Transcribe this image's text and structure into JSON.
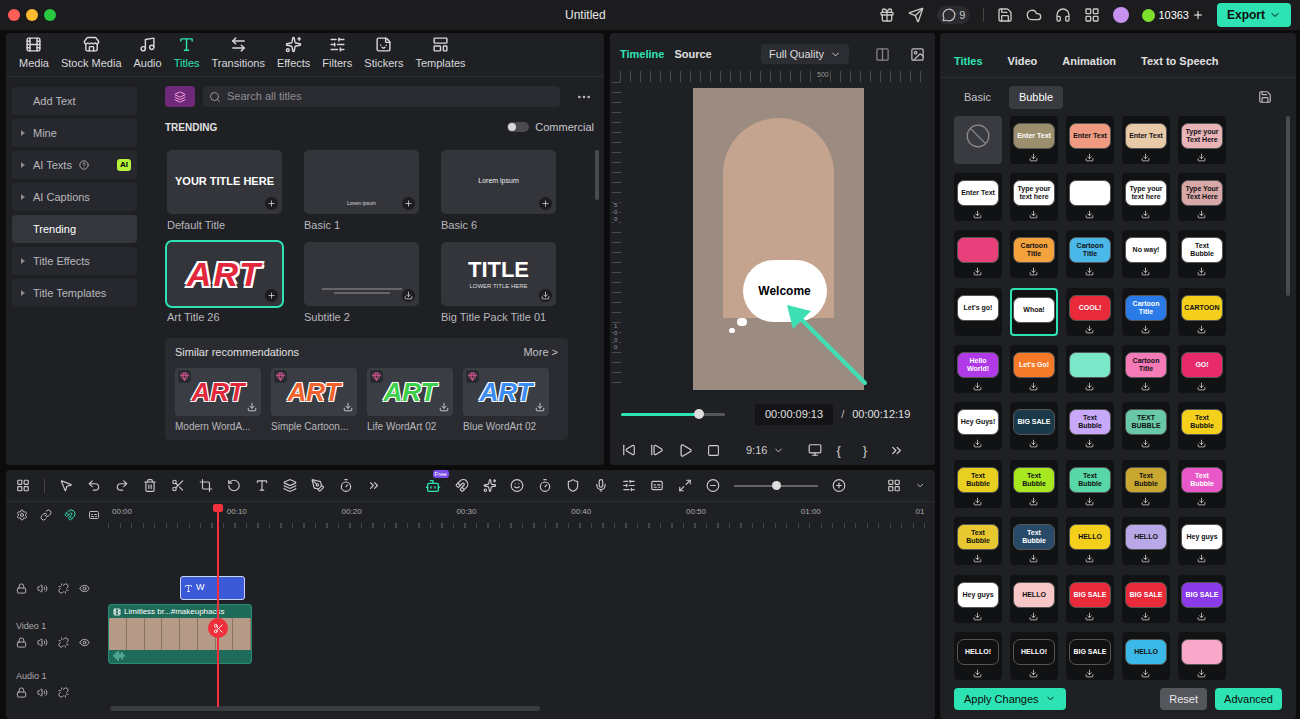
{
  "window": {
    "title": "Untitled"
  },
  "topbar": {
    "notifications": "9",
    "credits": "10363",
    "export": "Export"
  },
  "media_tabs": [
    {
      "label": "Media",
      "selected": false
    },
    {
      "label": "Stock Media",
      "selected": false
    },
    {
      "label": "Audio",
      "selected": false
    },
    {
      "label": "Titles",
      "selected": true
    },
    {
      "label": "Transitions",
      "selected": false
    },
    {
      "label": "Effects",
      "selected": false
    },
    {
      "label": "Filters",
      "selected": false
    },
    {
      "label": "Stickers",
      "selected": false
    },
    {
      "label": "Templates",
      "selected": false
    }
  ],
  "sidebar": [
    {
      "label": "Add Text",
      "kind": "button",
      "selected": false,
      "badge": ""
    },
    {
      "label": "Mine",
      "kind": "group",
      "selected": false,
      "badge": ""
    },
    {
      "label": "AI Texts",
      "kind": "group",
      "selected": false,
      "badge": "AI"
    },
    {
      "label": "AI Captions",
      "kind": "group",
      "selected": false,
      "badge": ""
    },
    {
      "label": "Trending",
      "kind": "item",
      "selected": true,
      "badge": ""
    },
    {
      "label": "Title Effects",
      "kind": "group",
      "selected": false,
      "badge": ""
    },
    {
      "label": "Title Templates",
      "kind": "group",
      "selected": false,
      "badge": ""
    }
  ],
  "search": {
    "placeholder": "Search all titles"
  },
  "section": {
    "title": "TRENDING",
    "toggle_label": "Commercial",
    "toggle_on": false
  },
  "titles": [
    {
      "name": "Default Title",
      "kind": "plain",
      "preview": "YOUR TITLE HERE",
      "preview_sub": "",
      "selected": false,
      "downloaded": true
    },
    {
      "name": "Basic 1",
      "kind": "caption",
      "preview": "Lorem ipsum",
      "preview_sub": "",
      "selected": false,
      "downloaded": true
    },
    {
      "name": "Basic 6",
      "kind": "small",
      "preview": "Lorem ipsum",
      "preview_sub": "",
      "selected": false,
      "downloaded": true
    },
    {
      "name": "Art Title 26",
      "kind": "art",
      "preview": "ART",
      "preview_sub": "",
      "selected": true,
      "downloaded": true
    },
    {
      "name": "Subtitle 2",
      "kind": "subtitle",
      "preview": "",
      "preview_sub": "",
      "selected": false,
      "downloaded": false
    },
    {
      "name": "Big Title Pack Title 01",
      "kind": "big",
      "preview": "TITLE",
      "preview_sub": "LOWER TITLE HERE",
      "selected": false,
      "downloaded": false
    }
  ],
  "recommendations": {
    "title": "Similar recommendations",
    "more": "More >",
    "items": [
      {
        "name": "Modern WordA...",
        "preview": "ART",
        "color": "#e3283c"
      },
      {
        "name": "Simple Cartoon...",
        "preview": "ART",
        "color": "#f0622a"
      },
      {
        "name": "Life WordArt 02",
        "preview": "ART",
        "color": "#3ecf4a"
      },
      {
        "name": "Blue WordArt 02",
        "preview": "ART",
        "color": "#3a8cf0"
      }
    ]
  },
  "preview": {
    "tabs": [
      {
        "label": "Timeline",
        "selected": true
      },
      {
        "label": "Source",
        "selected": false
      }
    ],
    "quality": "Full Quality",
    "ruler_top": "500",
    "ruler_left": [
      "500",
      "1000"
    ],
    "overlay": "Welcome",
    "level": 0.75,
    "time": "00:00:09:13",
    "separator": "/",
    "duration": "00:00:12:19",
    "ratio": "9:16",
    "mark_in": "{",
    "mark_out": "}"
  },
  "inspector": {
    "tabs": [
      {
        "label": "Titles",
        "selected": true
      },
      {
        "label": "Video",
        "selected": false
      },
      {
        "label": "Animation",
        "selected": false
      },
      {
        "label": "Text to Speech",
        "selected": false
      }
    ],
    "subtabs": [
      {
        "label": "Basic",
        "selected": false
      },
      {
        "label": "Bubble",
        "selected": true
      }
    ],
    "presets": [
      {
        "kind": "none",
        "text": "",
        "color": "#3a3b40",
        "selected": false,
        "downloaded": true
      },
      {
        "kind": "shape",
        "text": "Enter Text",
        "color": "#9b8f6e",
        "selected": false,
        "downloaded": false
      },
      {
        "kind": "shape",
        "text": "Enter Text",
        "color": "#f09a82",
        "selected": false,
        "downloaded": false
      },
      {
        "kind": "shape",
        "text": "Enter Text",
        "color": "#e8c9a8",
        "selected": false,
        "downloaded": false
      },
      {
        "kind": "shape",
        "text": "Type your Text Here",
        "color": "#e8b4b8",
        "selected": false,
        "downloaded": false
      },
      {
        "kind": "shape",
        "text": "Enter Text",
        "color": "#ffffff",
        "selected": false,
        "downloaded": false
      },
      {
        "kind": "shape",
        "text": "Type your text here",
        "color": "#ffffff",
        "selected": false,
        "downloaded": false
      },
      {
        "kind": "shape",
        "text": "",
        "color": "#ffffff",
        "selected": false,
        "downloaded": false
      },
      {
        "kind": "shape",
        "text": "Type your text here",
        "color": "#ffffff",
        "selected": false,
        "downloaded": false
      },
      {
        "kind": "shape",
        "text": "Type Your Text Here",
        "color": "#d8a8a8",
        "selected": false,
        "downloaded": false
      },
      {
        "kind": "shape",
        "text": "",
        "color": "#e8407a",
        "selected": false,
        "downloaded": false
      },
      {
        "kind": "shape",
        "text": "Cartoon Title",
        "color": "#f4a23c",
        "selected": false,
        "downloaded": false
      },
      {
        "kind": "shape",
        "text": "Cartoon Title",
        "color": "#4ab8e8",
        "selected": false,
        "downloaded": false
      },
      {
        "kind": "shape",
        "text": "No way!",
        "color": "#ffffff",
        "selected": false,
        "downloaded": false
      },
      {
        "kind": "shape",
        "text": "Text Bubble",
        "color": "#ffffff",
        "selected": false,
        "downloaded": false
      },
      {
        "kind": "shape",
        "text": "Let's go!",
        "color": "#ffffff",
        "selected": false,
        "downloaded": true
      },
      {
        "kind": "shape",
        "text": "Whoa!",
        "color": "#ffffff",
        "selected": true,
        "downloaded": true
      },
      {
        "kind": "shape",
        "text": "COOL!",
        "color": "#e82a3a",
        "selected": false,
        "downloaded": false
      },
      {
        "kind": "shape",
        "text": "Cartoon Title",
        "color": "#2a7ae8",
        "selected": false,
        "downloaded": false
      },
      {
        "kind": "shape",
        "text": "CARTOON",
        "color": "#f4d01c",
        "selected": false,
        "downloaded": false
      },
      {
        "kind": "shape",
        "text": "Hello World!",
        "color": "#b03ae8",
        "selected": false,
        "downloaded": false
      },
      {
        "kind": "shape",
        "text": "Let's Go!",
        "color": "#f47a2a",
        "selected": false,
        "downloaded": false
      },
      {
        "kind": "shape",
        "text": "",
        "color": "#7ae8c8",
        "selected": false,
        "downloaded": false
      },
      {
        "kind": "shape",
        "text": "Cartoon Title",
        "color": "#f47ab8",
        "selected": false,
        "downloaded": false
      },
      {
        "kind": "shape",
        "text": "GO!",
        "color": "#e82a6a",
        "selected": false,
        "downloaded": false
      },
      {
        "kind": "shape",
        "text": "Hey Guys!",
        "color": "#ffffff",
        "selected": false,
        "downloaded": false
      },
      {
        "kind": "shape",
        "text": "BIG SALE",
        "color": "#1a3a4a",
        "selected": false,
        "downloaded": false
      },
      {
        "kind": "shape",
        "text": "Text Bubble",
        "color": "#c8a8f8",
        "selected": false,
        "downloaded": false
      },
      {
        "kind": "shape",
        "text": "TEXT BUBBLE",
        "color": "#68c8a8",
        "selected": false,
        "downloaded": false
      },
      {
        "kind": "shape",
        "text": "Text Bubble",
        "color": "#f4d01c",
        "selected": false,
        "downloaded": false
      },
      {
        "kind": "shape",
        "text": "Text Bubble",
        "color": "#e8d020",
        "selected": false,
        "downloaded": false
      },
      {
        "kind": "shape",
        "text": "Text Bubble",
        "color": "#a8e820",
        "selected": false,
        "downloaded": false
      },
      {
        "kind": "shape",
        "text": "Text Bubble",
        "color": "#58d8a8",
        "selected": false,
        "downloaded": false
      },
      {
        "kind": "shape",
        "text": "Text Bubble",
        "color": "#c8a830",
        "selected": false,
        "downloaded": false
      },
      {
        "kind": "shape",
        "text": "Text Bubble",
        "color": "#e858c8",
        "selected": false,
        "downloaded": false
      },
      {
        "kind": "shape",
        "text": "Text Bubble",
        "color": "#e8c830",
        "selected": false,
        "downloaded": false
      },
      {
        "kind": "shape",
        "text": "Text Bubble",
        "color": "#2a4a6a",
        "selected": false,
        "downloaded": false
      },
      {
        "kind": "shape",
        "text": "HELLO",
        "color": "#f4d01c",
        "selected": false,
        "downloaded": false
      },
      {
        "kind": "shape",
        "text": "HELLO",
        "color": "#b8a8e8",
        "selected": false,
        "downloaded": false
      },
      {
        "kind": "shape",
        "text": "Hey guys",
        "color": "#ffffff",
        "selected": false,
        "downloaded": false
      },
      {
        "kind": "shape",
        "text": "Hey guys",
        "color": "#ffffff",
        "selected": false,
        "downloaded": false
      },
      {
        "kind": "shape",
        "text": "HELLO",
        "color": "#f8c8c8",
        "selected": false,
        "downloaded": false
      },
      {
        "kind": "shape",
        "text": "BIG SALE",
        "color": "#e82a3a",
        "selected": false,
        "downloaded": false
      },
      {
        "kind": "shape",
        "text": "BIG SALE",
        "color": "#e82a3a",
        "selected": false,
        "downloaded": false
      },
      {
        "kind": "shape",
        "text": "BIG SALE",
        "color": "#8a3ae8",
        "selected": false,
        "downloaded": false
      },
      {
        "kind": "shape",
        "text": "HELLO!",
        "color": "#111111",
        "selected": false,
        "downloaded": false
      },
      {
        "kind": "shape",
        "text": "HELLO!",
        "color": "#111111",
        "selected": false,
        "downloaded": false
      },
      {
        "kind": "shape",
        "text": "BIG SALE",
        "color": "#111111",
        "selected": false,
        "downloaded": false
      },
      {
        "kind": "shape",
        "text": "HELLO",
        "color": "#3ab8e8",
        "selected": false,
        "downloaded": false
      },
      {
        "kind": "shape",
        "text": "",
        "color": "#f8a8c8",
        "selected": false,
        "downloaded": false
      }
    ],
    "apply": "Apply Changes",
    "reset": "Reset",
    "advanced": "Advanced"
  },
  "timeline": {
    "free_badge": "Free",
    "ruler": [
      "00:00",
      "00:10",
      "00:20",
      "00:30",
      "00:40",
      "00:50",
      "01:00",
      "01"
    ],
    "playhead": 0.133,
    "zoom": 0.5,
    "title_clip": "W",
    "video_clip": "Limitless br...#makeuphacks",
    "tracks": [
      "Video 1",
      "Audio 1"
    ]
  }
}
